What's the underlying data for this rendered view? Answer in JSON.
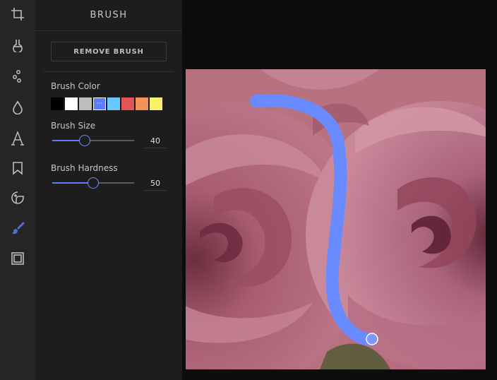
{
  "rail": {
    "tools": [
      {
        "name": "crop-icon"
      },
      {
        "name": "filter-icon"
      },
      {
        "name": "adjust-icon"
      },
      {
        "name": "drop-icon"
      },
      {
        "name": "text-icon"
      },
      {
        "name": "bookmark-icon"
      },
      {
        "name": "sticker-icon"
      },
      {
        "name": "brush-icon",
        "active": true
      },
      {
        "name": "frame-icon"
      }
    ],
    "active_color": "#4f6fd1",
    "icon_color": "#bdbdbd"
  },
  "panel": {
    "title": "BRUSH",
    "remove_label": "REMOVE BRUSH",
    "color_label": "Brush Color",
    "size_label": "Brush Size",
    "size_value": "40",
    "size_fraction": 0.4,
    "hardness_label": "Brush Hardness",
    "hardness_value": "50",
    "hardness_fraction": 0.5,
    "colors": [
      "#000000",
      "#ffffff",
      "#bdbdbd",
      "#5b7cff",
      "#67c9ff",
      "#e25555",
      "#f49258",
      "#f6f06a"
    ],
    "selected_color_index": 3,
    "selected_marker": "···"
  },
  "canvas": {
    "brush_stroke_color": "#6a8bff"
  }
}
